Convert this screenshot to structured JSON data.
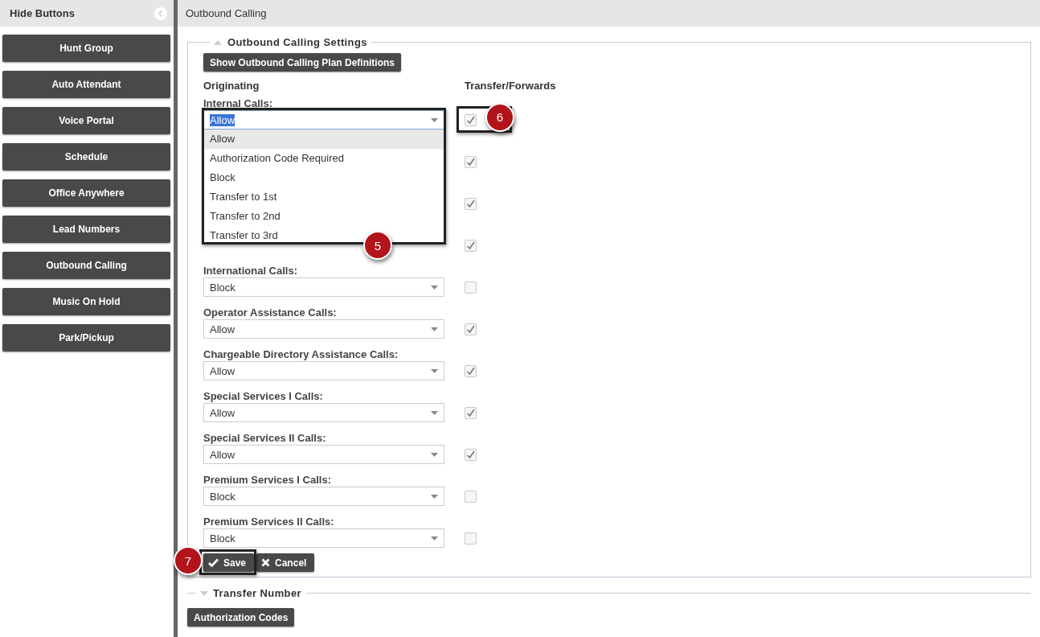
{
  "sidebar": {
    "title": "Hide Buttons",
    "items": [
      {
        "label": "Hunt Group"
      },
      {
        "label": "Auto Attendant"
      },
      {
        "label": "Voice Portal"
      },
      {
        "label": "Schedule"
      },
      {
        "label": "Office Anywhere"
      },
      {
        "label": "Lead Numbers"
      },
      {
        "label": "Outbound Calling"
      },
      {
        "label": "Music On Hold"
      },
      {
        "label": "Park/Pickup"
      }
    ]
  },
  "page_title": "Outbound Calling",
  "settings": {
    "legend": "Outbound Calling Settings",
    "expanded": true,
    "definitions_button": "Show Outbound Calling Plan Definitions",
    "column_headers": [
      "Originating",
      "Transfer/Forwards"
    ],
    "rows": [
      {
        "label": "Internal Calls:",
        "value": "Allow",
        "focused": true,
        "transfer_checked": true,
        "callout": "6",
        "dropdown": {
          "callout": "5",
          "options": [
            {
              "label": "Allow",
              "selected": true
            },
            {
              "label": "Authorization Code Required",
              "selected": false
            },
            {
              "label": "Block",
              "selected": false
            },
            {
              "label": "Transfer to 1st",
              "selected": false
            },
            {
              "label": "Transfer to 2nd",
              "selected": false
            },
            {
              "label": "Transfer to 3rd",
              "selected": false
            }
          ]
        }
      },
      {
        "transfer_checked": true
      },
      {
        "transfer_checked": true
      },
      {
        "transfer_checked": true
      },
      {
        "label": "International Calls:",
        "value": "Block",
        "transfer_checked": false
      },
      {
        "label": "Operator Assistance Calls:",
        "value": "Allow",
        "transfer_checked": true
      },
      {
        "label": "Chargeable Directory Assistance Calls:",
        "value": "Allow",
        "transfer_checked": true
      },
      {
        "label": "Special Services I Calls:",
        "value": "Allow",
        "transfer_checked": true
      },
      {
        "label": "Special Services II Calls:",
        "value": "Allow",
        "transfer_checked": true
      },
      {
        "label": "Premium Services I Calls:",
        "value": "Block",
        "transfer_checked": false
      },
      {
        "label": "Premium Services II Calls:",
        "value": "Block",
        "transfer_checked": false
      }
    ],
    "save_button": {
      "label": "Save",
      "callout": "7"
    },
    "cancel_button": {
      "label": "Cancel"
    }
  },
  "transfer_number": {
    "legend": "Transfer Number",
    "expanded": false
  },
  "authorization_button": "Authorization Codes"
}
